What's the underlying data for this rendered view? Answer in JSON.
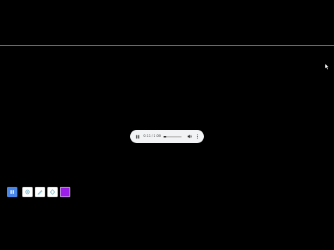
{
  "player": {
    "current_time": "0:11",
    "separator": "/",
    "duration": "1:08",
    "progress_fraction": 0.16,
    "pause_icon": "pause-icon",
    "volume_icon": "volume-icon",
    "more_icon": "more-vertical-icon"
  },
  "toolbar": {
    "buttons": [
      {
        "icon": "pause-icon",
        "color": "#4a86e8"
      },
      {
        "icon": "crosshair-icon",
        "color": "#ffffff"
      },
      {
        "icon": "pen-icon",
        "color": "#ffffff"
      },
      {
        "icon": "diamond-icon",
        "color": "#ffffff"
      },
      {
        "icon": "color-swatch",
        "color": "#9b1fe8"
      }
    ]
  },
  "colors": {
    "background": "#000000",
    "divider": "#6b6b6b",
    "accent": "#4a86e8",
    "swatch": "#9b1fe8"
  }
}
